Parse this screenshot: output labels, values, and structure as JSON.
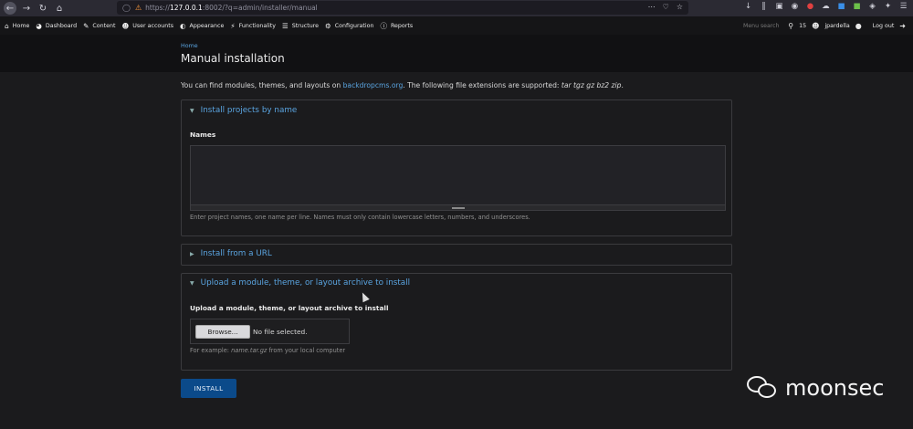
{
  "browser": {
    "url_host": "127.0.0.1",
    "url_rest": ":8002/?q=admin/installer/manual",
    "url_prefix": "https://"
  },
  "adminbar": {
    "items": [
      {
        "label": "Home",
        "icon": "home-icon"
      },
      {
        "label": "Dashboard",
        "icon": "dashboard-icon"
      },
      {
        "label": "Content",
        "icon": "pencil-icon"
      },
      {
        "label": "User accounts",
        "icon": "users-icon"
      },
      {
        "label": "Appearance",
        "icon": "palette-icon"
      },
      {
        "label": "Functionality",
        "icon": "plug-icon"
      },
      {
        "label": "Structure",
        "icon": "layers-icon"
      },
      {
        "label": "Configuration",
        "icon": "gear-icon"
      },
      {
        "label": "Reports",
        "icon": "info-icon"
      }
    ],
    "search_placeholder": "Menu search",
    "user_count": "15",
    "username": "jpardella",
    "logout": "Log out"
  },
  "header": {
    "breadcrumb": "Home",
    "title": "Manual installation"
  },
  "intro": {
    "prefix": "You can find modules, themes, and layouts on ",
    "link": "backdropcms.org",
    "middle": ". The following file extensions are supported: ",
    "extensions": "tar tgz gz bz2 zip",
    "suffix": "."
  },
  "by_name": {
    "legend": "Install projects by name",
    "label": "Names",
    "help": "Enter project names, one name per line. Names must only contain lowercase letters, numbers, and underscores."
  },
  "from_url": {
    "legend": "Install from a URL"
  },
  "upload": {
    "legend": "Upload a module, theme, or layout archive to install",
    "label": "Upload a module, theme, or layout archive to install",
    "browse": "Browse...",
    "no_file": "No file selected.",
    "help_prefix": "For example: ",
    "help_example": "name.tar.gz",
    "help_suffix": " from your local computer"
  },
  "install_button": "INSTALL",
  "watermark": "moonsec"
}
